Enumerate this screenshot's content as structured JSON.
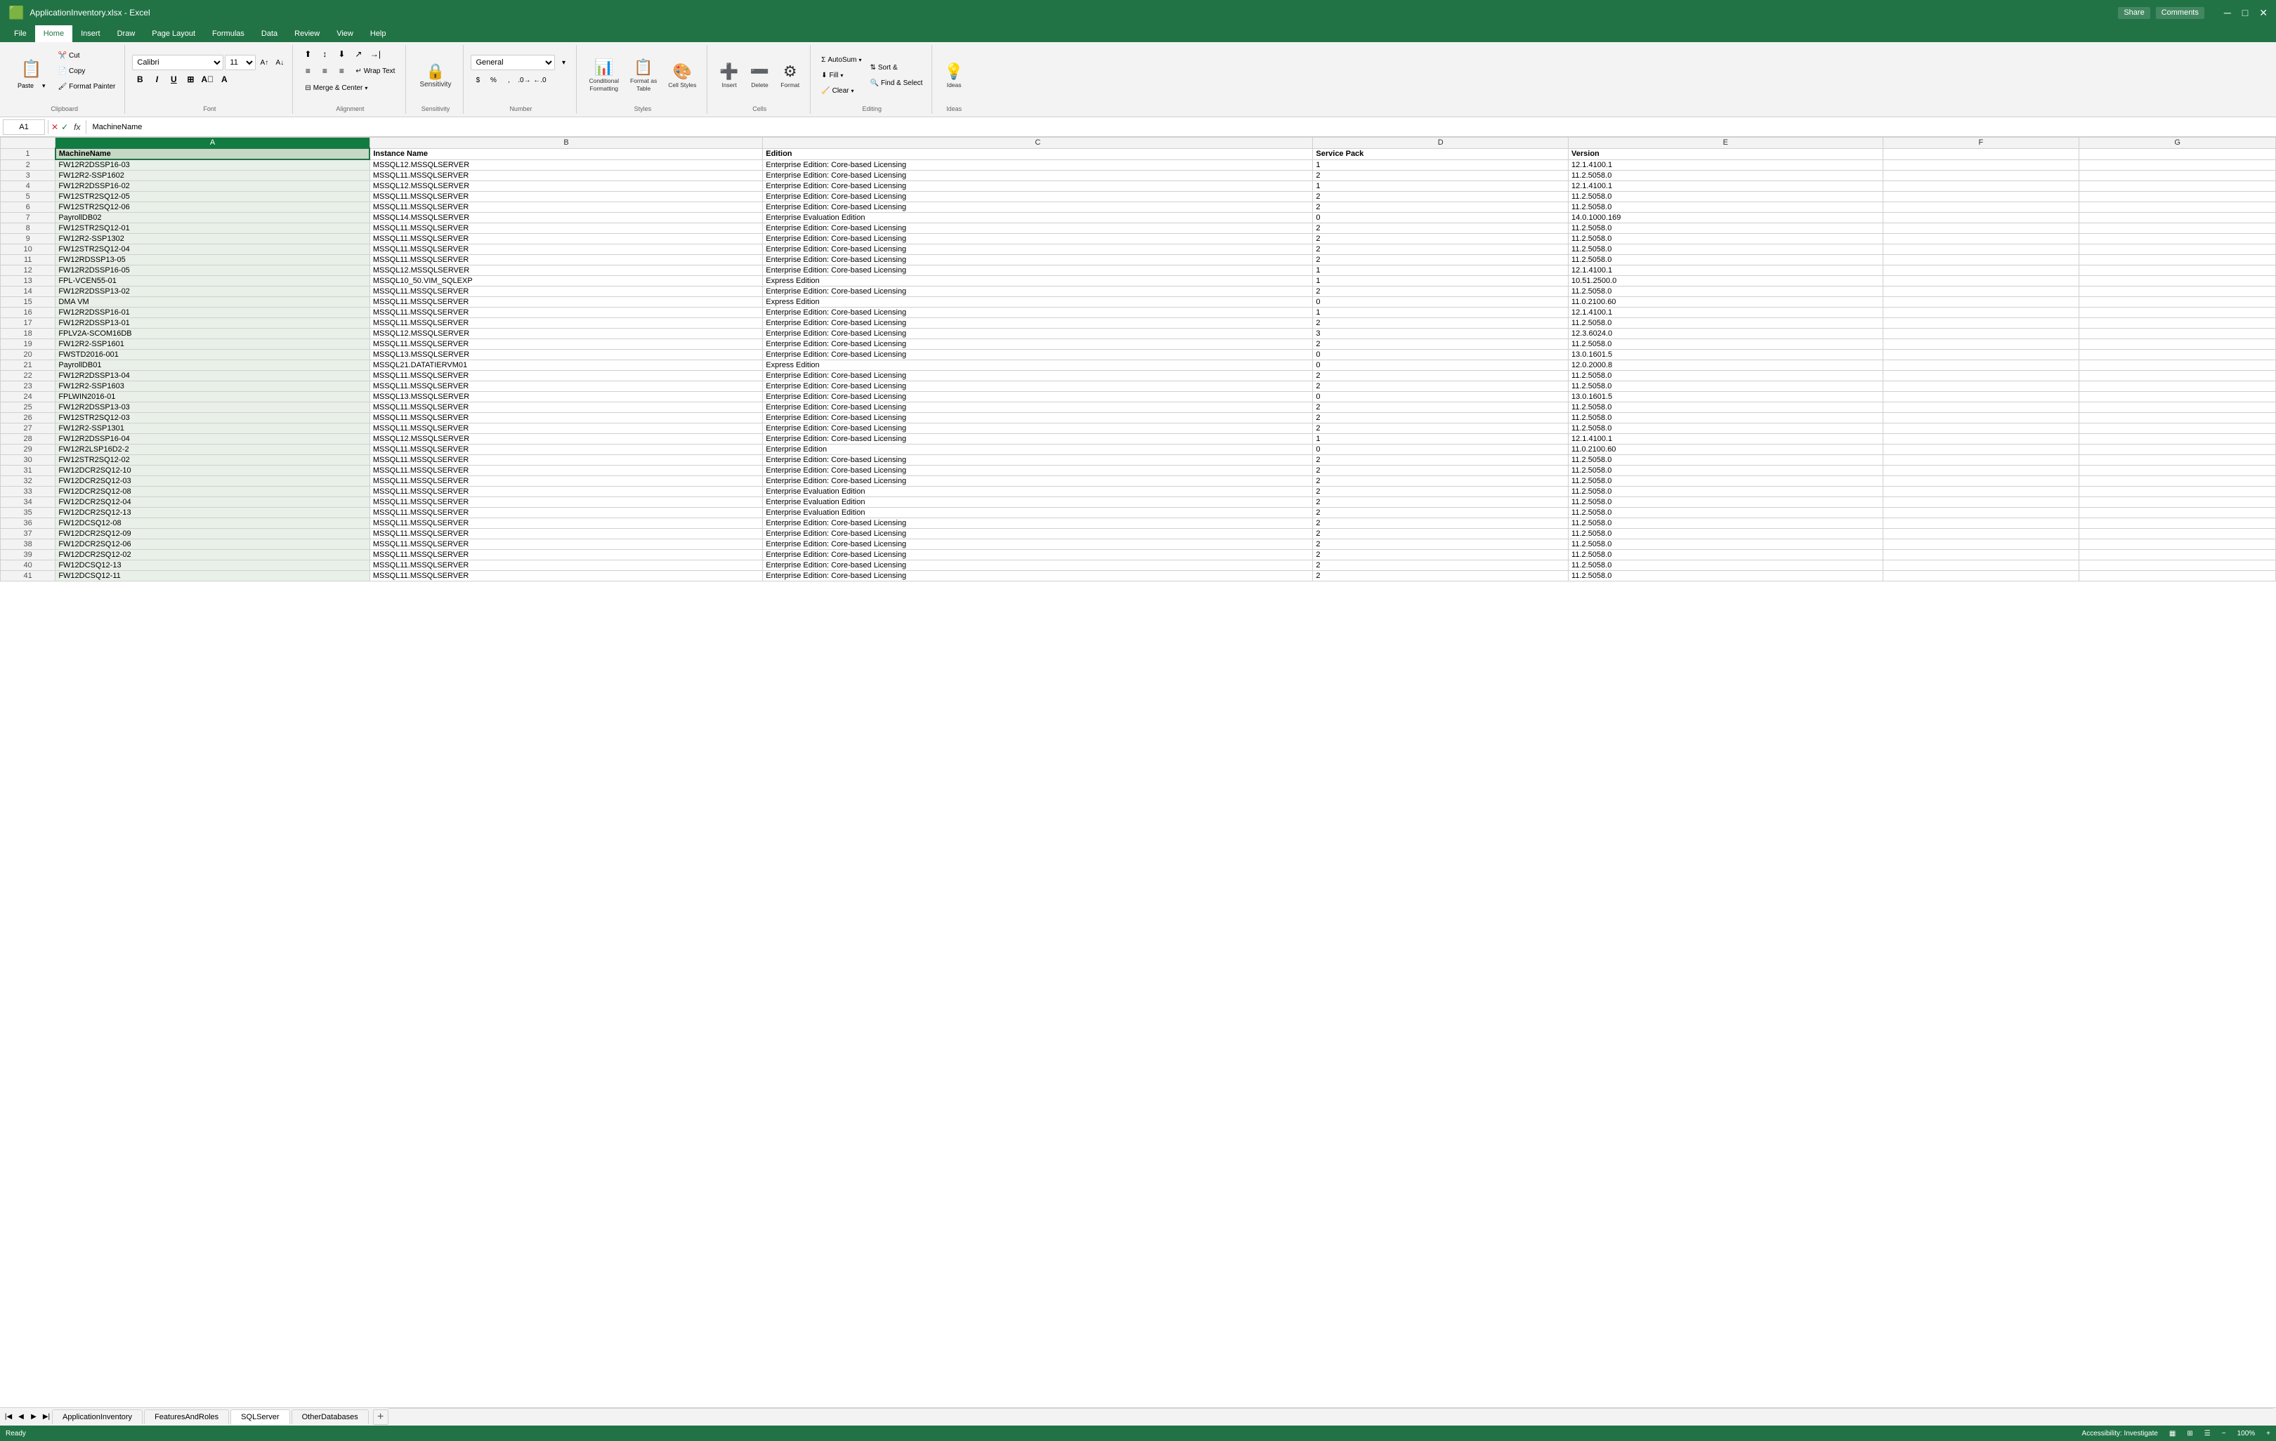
{
  "titleBar": {
    "title": "ApplicationInventory.xlsx - Excel",
    "shareLabel": "Share",
    "commentsLabel": "Comments"
  },
  "ribbonTabs": [
    {
      "id": "file",
      "label": "File"
    },
    {
      "id": "home",
      "label": "Home",
      "active": true
    },
    {
      "id": "insert",
      "label": "Insert"
    },
    {
      "id": "draw",
      "label": "Draw"
    },
    {
      "id": "page-layout",
      "label": "Page Layout"
    },
    {
      "id": "formulas",
      "label": "Formulas"
    },
    {
      "id": "data",
      "label": "Data"
    },
    {
      "id": "review",
      "label": "Review"
    },
    {
      "id": "view",
      "label": "View"
    },
    {
      "id": "help",
      "label": "Help"
    }
  ],
  "clipboard": {
    "pasteLabel": "Paste",
    "cutLabel": "Cut",
    "copyLabel": "Copy",
    "formatPainterLabel": "Format Painter",
    "groupLabel": "Clipboard"
  },
  "font": {
    "fontName": "Calibri",
    "fontSize": "11",
    "boldLabel": "B",
    "italicLabel": "I",
    "underlineLabel": "U",
    "groupLabel": "Font"
  },
  "alignment": {
    "wrapTextLabel": "Wrap Text",
    "mergeLabel": "Merge & Center",
    "groupLabel": "Alignment"
  },
  "sensitivity": {
    "label": "Sensitivity",
    "groupLabel": "Sensitivity"
  },
  "number": {
    "format": "General",
    "groupLabel": "Number"
  },
  "styles": {
    "conditionalLabel": "Conditional\nFormatting",
    "formatTableLabel": "Format as\nTable",
    "cellStylesLabel": "Cell\nStyles",
    "groupLabel": "Styles",
    "formattingLabel": "Formatting",
    "tableLabel": "Table",
    "cellStylesShort": "Cell Styles"
  },
  "cells": {
    "insertLabel": "Insert",
    "deleteLabel": "Delete",
    "formatLabel": "Format",
    "groupLabel": "Cells"
  },
  "editing": {
    "autoSumLabel": "AutoSum",
    "fillLabel": "Fill",
    "clearLabel": "Clear",
    "sortFilterLabel": "Sort &\nFilter",
    "findSelectLabel": "Find &\nSelect",
    "groupLabel": "Editing"
  },
  "ideas": {
    "label": "Ideas",
    "groupLabel": "Ideas"
  },
  "formulaBar": {
    "cellRef": "A1",
    "fxLabel": "fx",
    "formula": "MachineName"
  },
  "columnHeaders": [
    "A",
    "B",
    "C",
    "D",
    "E",
    "F",
    "G"
  ],
  "columnWidths": [
    "160px",
    "200px",
    "280px",
    "130px",
    "160px",
    "100px",
    "100px"
  ],
  "dataHeaders": {
    "a": "MachineName",
    "b": "Instance Name",
    "c": "Edition",
    "d": "Service Pack",
    "e": "Version"
  },
  "tableData": [
    [
      "FW12R2DSSP16-03",
      "MSSQL12.MSSQLSERVER",
      "Enterprise Edition: Core-based Licensing",
      "1",
      "12.1.4100.1"
    ],
    [
      "FW12R2-SSP1602",
      "MSSQL11.MSSQLSERVER",
      "Enterprise Edition: Core-based Licensing",
      "2",
      "11.2.5058.0"
    ],
    [
      "FW12R2DSSP16-02",
      "MSSQL12.MSSQLSERVER",
      "Enterprise Edition: Core-based Licensing",
      "1",
      "12.1.4100.1"
    ],
    [
      "FW12STR2SQ12-05",
      "MSSQL11.MSSQLSERVER",
      "Enterprise Edition: Core-based Licensing",
      "2",
      "11.2.5058.0"
    ],
    [
      "FW12STR2SQ12-06",
      "MSSQL11.MSSQLSERVER",
      "Enterprise Edition: Core-based Licensing",
      "2",
      "11.2.5058.0"
    ],
    [
      "PayrollDB02",
      "MSSQL14.MSSQLSERVER",
      "Enterprise Evaluation Edition",
      "0",
      "14.0.1000.169"
    ],
    [
      "FW12STR2SQ12-01",
      "MSSQL11.MSSQLSERVER",
      "Enterprise Edition: Core-based Licensing",
      "2",
      "11.2.5058.0"
    ],
    [
      "FW12R2-SSP1302",
      "MSSQL11.MSSQLSERVER",
      "Enterprise Edition: Core-based Licensing",
      "2",
      "11.2.5058.0"
    ],
    [
      "FW12STR2SQ12-04",
      "MSSQL11.MSSQLSERVER",
      "Enterprise Edition: Core-based Licensing",
      "2",
      "11.2.5058.0"
    ],
    [
      "FW12RDSSP13-05",
      "MSSQL11.MSSQLSERVER",
      "Enterprise Edition: Core-based Licensing",
      "2",
      "11.2.5058.0"
    ],
    [
      "FW12R2DSSP16-05",
      "MSSQL12.MSSQLSERVER",
      "Enterprise Edition: Core-based Licensing",
      "1",
      "12.1.4100.1"
    ],
    [
      "FPL-VCEN55-01",
      "MSSQL10_50.VIM_SQLEXP",
      "Express Edition",
      "1",
      "10.51.2500.0"
    ],
    [
      "FW12R2DSSP13-02",
      "MSSQL11.MSSQLSERVER",
      "Enterprise Edition: Core-based Licensing",
      "2",
      "11.2.5058.0"
    ],
    [
      "DMA VM",
      "MSSQL11.MSSQLSERVER",
      "Express Edition",
      "0",
      "11.0.2100.60"
    ],
    [
      "FW12R2DSSP16-01",
      "MSSQL11.MSSQLSERVER",
      "Enterprise Edition: Core-based Licensing",
      "1",
      "12.1.4100.1"
    ],
    [
      "FW12R2DSSP13-01",
      "MSSQL11.MSSQLSERVER",
      "Enterprise Edition: Core-based Licensing",
      "2",
      "11.2.5058.0"
    ],
    [
      "FPLV2A-SCOM16DB",
      "MSSQL12.MSSQLSERVER",
      "Enterprise Edition: Core-based Licensing",
      "3",
      "12.3.6024.0"
    ],
    [
      "FW12R2-SSP1601",
      "MSSQL11.MSSQLSERVER",
      "Enterprise Edition: Core-based Licensing",
      "2",
      "11.2.5058.0"
    ],
    [
      "FWSTD2016-001",
      "MSSQL13.MSSQLSERVER",
      "Enterprise Edition: Core-based Licensing",
      "0",
      "13.0.1601.5"
    ],
    [
      "PayrollDB01",
      "MSSQL21.DATATIERVM01",
      "Express Edition",
      "0",
      "12.0.2000.8"
    ],
    [
      "FW12R2DSSP13-04",
      "MSSQL11.MSSQLSERVER",
      "Enterprise Edition: Core-based Licensing",
      "2",
      "11.2.5058.0"
    ],
    [
      "FW12R2-SSP1603",
      "MSSQL11.MSSQLSERVER",
      "Enterprise Edition: Core-based Licensing",
      "2",
      "11.2.5058.0"
    ],
    [
      "FPLWIN2016-01",
      "MSSQL13.MSSQLSERVER",
      "Enterprise Edition: Core-based Licensing",
      "0",
      "13.0.1601.5"
    ],
    [
      "FW12R2DSSP13-03",
      "MSSQL11.MSSQLSERVER",
      "Enterprise Edition: Core-based Licensing",
      "2",
      "11.2.5058.0"
    ],
    [
      "FW12STR2SQ12-03",
      "MSSQL11.MSSQLSERVER",
      "Enterprise Edition: Core-based Licensing",
      "2",
      "11.2.5058.0"
    ],
    [
      "FW12R2-SSP1301",
      "MSSQL11.MSSQLSERVER",
      "Enterprise Edition: Core-based Licensing",
      "2",
      "11.2.5058.0"
    ],
    [
      "FW12R2DSSP16-04",
      "MSSQL12.MSSQLSERVER",
      "Enterprise Edition: Core-based Licensing",
      "1",
      "12.1.4100.1"
    ],
    [
      "FW12R2LSP16D2-2",
      "MSSQL11.MSSQLSERVER",
      "Enterprise Edition",
      "0",
      "11.0.2100.60"
    ],
    [
      "FW12STR2SQ12-02",
      "MSSQL11.MSSQLSERVER",
      "Enterprise Edition: Core-based Licensing",
      "2",
      "11.2.5058.0"
    ],
    [
      "FW12DCR2SQ12-10",
      "MSSQL11.MSSQLSERVER",
      "Enterprise Edition: Core-based Licensing",
      "2",
      "11.2.5058.0"
    ],
    [
      "FW12DCR2SQ12-03",
      "MSSQL11.MSSQLSERVER",
      "Enterprise Edition: Core-based Licensing",
      "2",
      "11.2.5058.0"
    ],
    [
      "FW12DCR2SQ12-08",
      "MSSQL11.MSSQLSERVER",
      "Enterprise Evaluation Edition",
      "2",
      "11.2.5058.0"
    ],
    [
      "FW12DCR2SQ12-04",
      "MSSQL11.MSSQLSERVER",
      "Enterprise Evaluation Edition",
      "2",
      "11.2.5058.0"
    ],
    [
      "FW12DCR2SQ12-13",
      "MSSQL11.MSSQLSERVER",
      "Enterprise Evaluation Edition",
      "2",
      "11.2.5058.0"
    ],
    [
      "FW12DCSQ12-08",
      "MSSQL11.MSSQLSERVER",
      "Enterprise Edition: Core-based Licensing",
      "2",
      "11.2.5058.0"
    ],
    [
      "FW12DCR2SQ12-09",
      "MSSQL11.MSSQLSERVER",
      "Enterprise Edition: Core-based Licensing",
      "2",
      "11.2.5058.0"
    ],
    [
      "FW12DCR2SQ12-06",
      "MSSQL11.MSSQLSERVER",
      "Enterprise Edition: Core-based Licensing",
      "2",
      "11.2.5058.0"
    ],
    [
      "FW12DCR2SQ12-02",
      "MSSQL11.MSSQLSERVER",
      "Enterprise Edition: Core-based Licensing",
      "2",
      "11.2.5058.0"
    ],
    [
      "FW12DCSQ12-13",
      "MSSQL11.MSSQLSERVER",
      "Enterprise Edition: Core-based Licensing",
      "2",
      "11.2.5058.0"
    ],
    [
      "FW12DCSQ12-11",
      "MSSQL11.MSSQLSERVER",
      "Enterprise Edition: Core-based Licensing",
      "2",
      "11.2.5058.0"
    ]
  ],
  "sheetTabs": [
    {
      "id": "app-inventory",
      "label": "ApplicationInventory"
    },
    {
      "id": "features-roles",
      "label": "FeaturesAndRoles"
    },
    {
      "id": "sql-server",
      "label": "SQLServer",
      "active": true
    },
    {
      "id": "other-databases",
      "label": "OtherDatabases"
    }
  ],
  "statusBar": {
    "ready": "Ready",
    "accessibility": "Accessibility: Investigate"
  }
}
